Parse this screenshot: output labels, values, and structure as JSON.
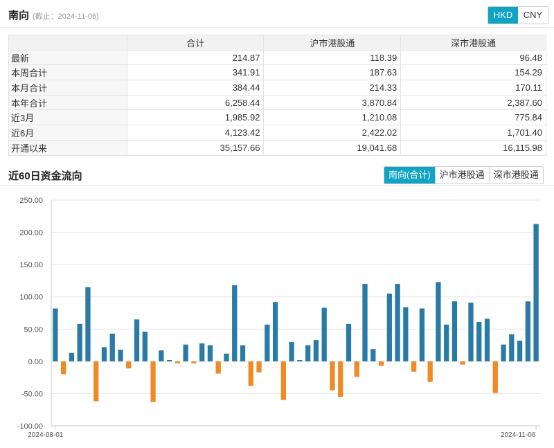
{
  "header": {
    "title": "南向",
    "date_note": "(截止：2024-11-06)",
    "currency": {
      "options": [
        "HKD",
        "CNY"
      ],
      "selected": "HKD"
    }
  },
  "summary_table": {
    "columns": [
      "",
      "合计",
      "沪市港股通",
      "深市港股通"
    ],
    "rows": [
      {
        "label": "最新",
        "values": [
          "214.87",
          "118.39",
          "96.48"
        ]
      },
      {
        "label": "本周合计",
        "values": [
          "341.91",
          "187.63",
          "154.29"
        ]
      },
      {
        "label": "本月合计",
        "values": [
          "384.44",
          "214.33",
          "170.11"
        ]
      },
      {
        "label": "本年合计",
        "values": [
          "6,258.44",
          "3,870.84",
          "2,387.60"
        ]
      },
      {
        "label": "近3月",
        "values": [
          "1,985.92",
          "1,210.08",
          "775.84"
        ]
      },
      {
        "label": "近6月",
        "values": [
          "4,123.42",
          "2,422.02",
          "1,701.40"
        ]
      },
      {
        "label": "开通以来",
        "values": [
          "35,157.66",
          "19,041.68",
          "16,115.98"
        ]
      }
    ]
  },
  "flow_section": {
    "title": "近60日资金流向",
    "tabs": [
      "南向(合计)",
      "沪市港股通",
      "深市港股通"
    ],
    "selected_tab": "南向(合计)"
  },
  "colors": {
    "accent": "#11a3c4",
    "positive": "#2a7aa6",
    "negative": "#f08a24"
  },
  "chart_data": {
    "type": "bar",
    "title": "",
    "xlabel": "",
    "ylabel": "",
    "ylim": [
      -100,
      250
    ],
    "y_ticks": [
      "250.00",
      "200.00",
      "150.00",
      "100.00",
      "50.00",
      "0.00",
      "-50.00",
      "-100.00"
    ],
    "y_tick_values": [
      250,
      200,
      150,
      100,
      50,
      0,
      -50,
      -100
    ],
    "x_tick_labels": [
      "2024-08-01",
      "2024-11-06"
    ],
    "grid": true,
    "values": [
      82,
      -20,
      13,
      58,
      115,
      -62,
      22,
      43,
      18,
      -11,
      65,
      46,
      -63,
      17,
      2,
      -3,
      26,
      -3,
      28,
      25,
      -19,
      12,
      118,
      25,
      -38,
      -17,
      57,
      92,
      -60,
      30,
      2,
      25,
      33,
      83,
      -45,
      -55,
      58,
      -24,
      120,
      19,
      -7,
      105,
      120,
      84,
      -16,
      82,
      -32,
      123,
      57,
      93,
      -5,
      91,
      61,
      66,
      -49,
      26,
      42,
      32,
      93,
      213
    ]
  }
}
